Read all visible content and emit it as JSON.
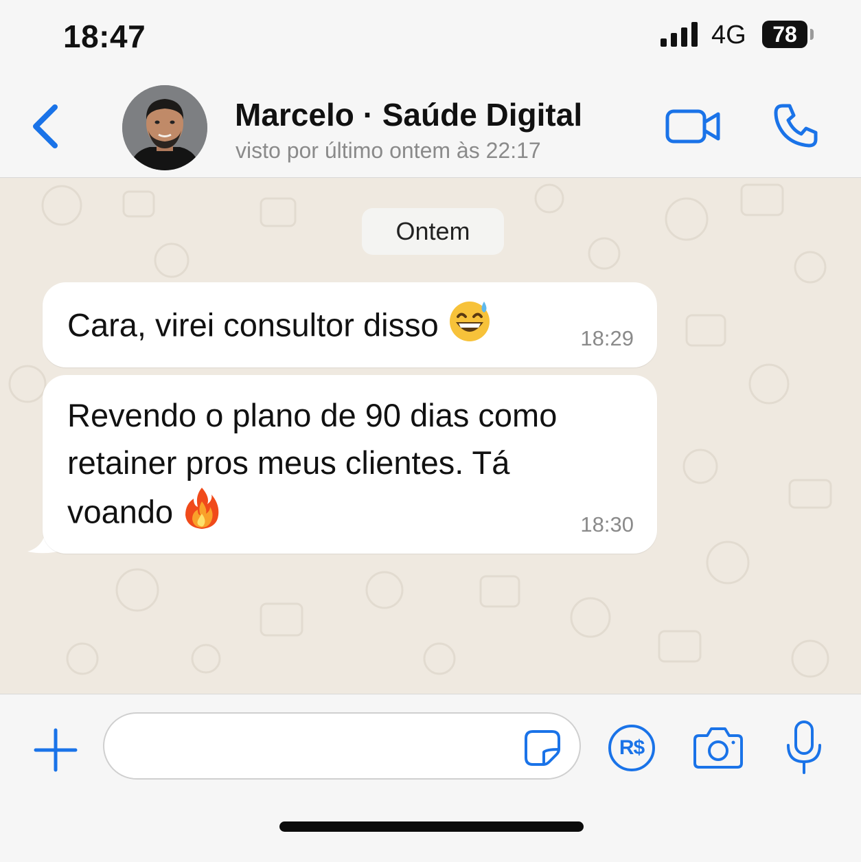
{
  "status_bar": {
    "time": "18:47",
    "network": "4G",
    "battery": "78",
    "signal_icon": "signal-bars-icon"
  },
  "header": {
    "back_icon": "chevron-left-icon",
    "contact_name": "Marcelo · Saúde Digital",
    "contact_status": "visto por último ontem às 22:17",
    "video_icon": "video-call-icon",
    "phone_icon": "phone-call-icon"
  },
  "chat": {
    "date_label": "Ontem",
    "messages": [
      {
        "text_lines": [
          "Cara, virei consultor disso"
        ],
        "emoji": "😅",
        "emoji_icon": "grinning-sweat-emoji",
        "time": "18:29"
      },
      {
        "text_lines": [
          "Revendo o plano de 90 dias como",
          "retainer pros meus clientes. Tá",
          "voando"
        ],
        "emoji": "🔥",
        "emoji_icon": "fire-emoji",
        "time": "18:30"
      }
    ]
  },
  "input_bar": {
    "plus_icon": "plus-icon",
    "input_value": "",
    "sticker_icon": "sticker-icon",
    "payment_label": "R$",
    "camera_icon": "camera-icon",
    "mic_icon": "microphone-icon"
  },
  "colors": {
    "accent": "#1a73e8",
    "chat_background": "#efe9e0",
    "bubble": "#ffffff",
    "secondary_text": "#8a8a8a"
  }
}
